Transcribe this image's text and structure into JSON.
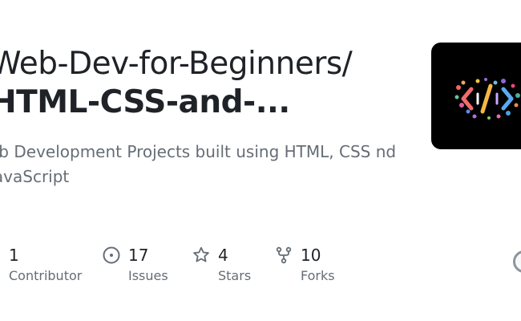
{
  "repo": {
    "owner_path": "Web-Dev-for-Beginners/",
    "name": "HTML-CSS-and-...",
    "description": "eb Development Projects built using HTML, CSS nd JavaScript"
  },
  "stats": {
    "contributors": {
      "value": "1",
      "label": "Contributor"
    },
    "issues": {
      "value": "17",
      "label": "Issues",
      "icon": "issue-opened-icon"
    },
    "stars": {
      "value": "4",
      "label": "Stars",
      "icon": "star-icon"
    },
    "forks": {
      "value": "10",
      "label": "Forks",
      "icon": "repo-forked-icon"
    }
  },
  "colors": {
    "title": "#1f2328",
    "muted": "#656d76",
    "logo_background": "#000000"
  }
}
